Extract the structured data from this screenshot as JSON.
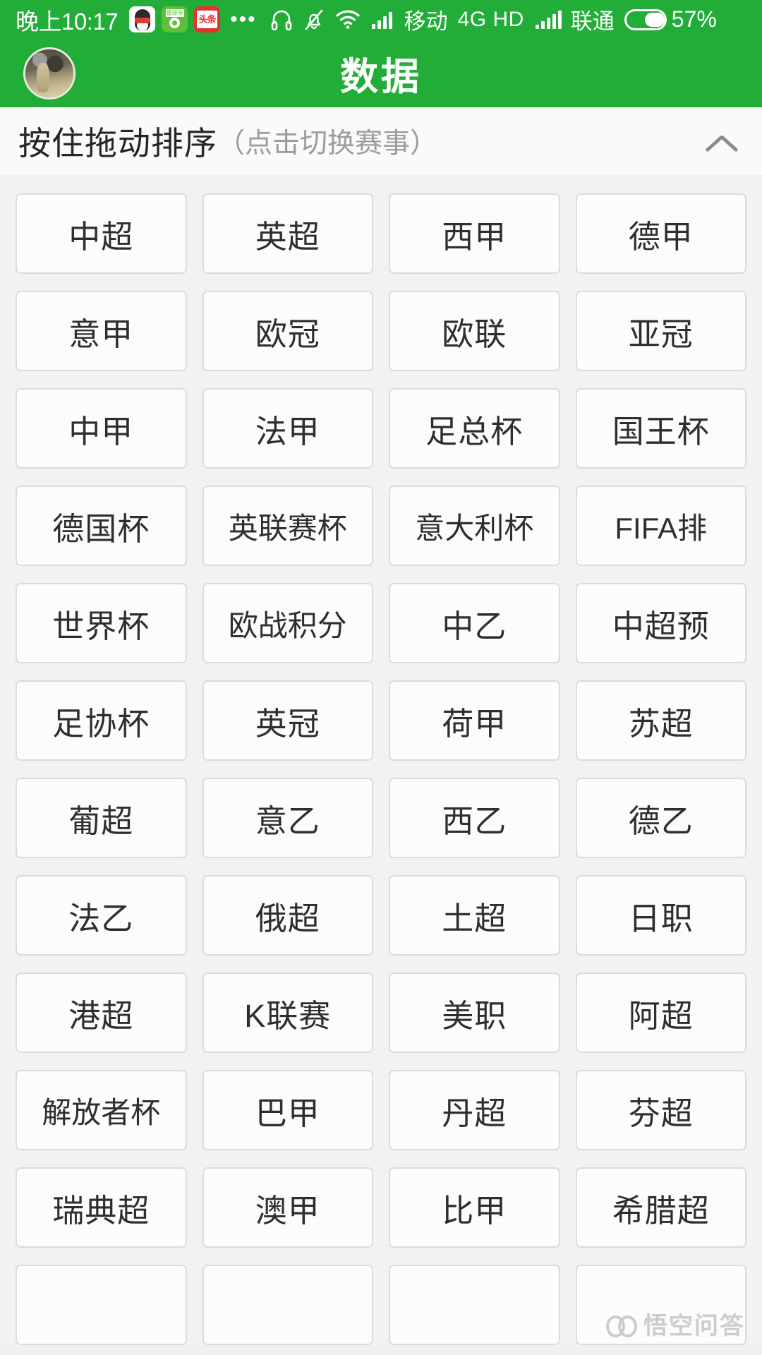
{
  "statusbar": {
    "time": "晚上10:17",
    "app_icons": [
      "qq-icon",
      "soccer-app-icon",
      "toutiao-news-icon"
    ],
    "overflow_dots": "•••",
    "icons": [
      "headphone-icon",
      "bell-muted-icon",
      "wifi-icon",
      "signal-bars-icon"
    ],
    "carrier1": "移动",
    "network": "4G HD",
    "carrier2": "联通",
    "battery_percent": "57%"
  },
  "titlebar": {
    "title": "数据",
    "avatar": "user-avatar"
  },
  "sort_header": {
    "main_text": "按住拖动排序",
    "sub_text": "（点击切换赛事）",
    "collapse_icon": "chevron-up-icon"
  },
  "grid": {
    "columns": 4,
    "items": [
      "中超",
      "英超",
      "西甲",
      "德甲",
      "意甲",
      "欧冠",
      "欧联",
      "亚冠",
      "中甲",
      "法甲",
      "足总杯",
      "国王杯",
      "德国杯",
      "英联赛杯",
      "意大利杯",
      "FIFA排",
      "世界杯",
      "欧战积分",
      "中乙",
      "中超预",
      "足协杯",
      "英冠",
      "荷甲",
      "苏超",
      "葡超",
      "意乙",
      "西乙",
      "德乙",
      "法乙",
      "俄超",
      "土超",
      "日职",
      "港超",
      "K联赛",
      "美职",
      "阿超",
      "解放者杯",
      "巴甲",
      "丹超",
      "芬超",
      "瑞典超",
      "澳甲",
      "比甲",
      "希腊超",
      "",
      "",
      "",
      ""
    ]
  },
  "watermark": {
    "text": "悟空问答",
    "logo": "wukong-logo-icon"
  },
  "colors": {
    "brand_green": "#22ac38",
    "page_bg": "#f2f2f2",
    "cell_bg": "#fcfcfc",
    "cell_border": "#dcdcdc",
    "text_primary": "#2e2e2e",
    "text_muted": "#9c9c9c"
  }
}
